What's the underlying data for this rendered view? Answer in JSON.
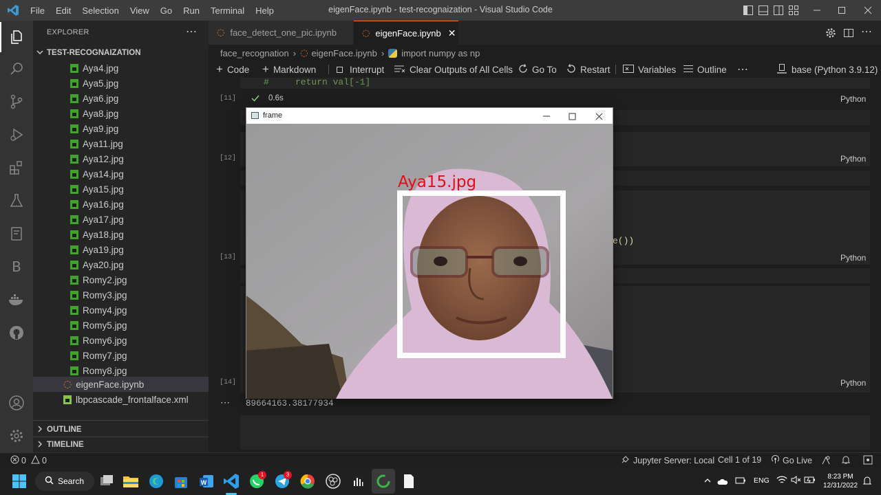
{
  "titlebar": {
    "menu": [
      "File",
      "Edit",
      "Selection",
      "View",
      "Go",
      "Run",
      "Terminal",
      "Help"
    ],
    "title": "eigenFace.ipynb - test-recognaization - Visual Studio Code"
  },
  "sidebar": {
    "header": "EXPLORER",
    "folder": "TEST-RECOGNAIZATION",
    "files": [
      "Aya4.jpg",
      "Aya5.jpg",
      "Aya6.jpg",
      "Aya8.jpg",
      "Aya9.jpg",
      "Aya11.jpg",
      "Aya12.jpg",
      "Aya14.jpg",
      "Aya15.jpg",
      "Aya16.jpg",
      "Aya17.jpg",
      "Aya18.jpg",
      "Aya19.jpg",
      "Aya20.jpg",
      "Romy2.jpg",
      "Romy3.jpg",
      "Romy4.jpg",
      "Romy5.jpg",
      "Romy6.jpg",
      "Romy7.jpg",
      "Romy8.jpg"
    ],
    "active_file": "eigenFace.ipynb",
    "xml_file": "lbpcascade_frontalface.xml",
    "outline": "OUTLINE",
    "timeline": "TIMELINE"
  },
  "tabs": [
    {
      "label": "face_detect_one_pic.ipynb"
    },
    {
      "label": "eigenFace.ipynb"
    }
  ],
  "breadcrumb": [
    "face_recognation",
    "eigenFace.ipynb",
    "import numpy as np"
  ],
  "toolbar": {
    "code": "Code",
    "markdown": "Markdown",
    "interrupt": "Interrupt",
    "clear": "Clear Outputs of All Cells",
    "goto": "Go To",
    "restart": "Restart",
    "variables": "Variables",
    "outline": "Outline",
    "kernel": "base (Python 3.9.12)"
  },
  "cells": {
    "code_line_hash": "#",
    "code_line_return": "return val[-1]",
    "exec_11": "[11]",
    "exec_12": "[12]",
    "exec_13": "[13]",
    "exec_14": "[14]",
    "time": "0.6s",
    "lang": "Python",
    "partial_code": "e())",
    "output": "89664163.38177934"
  },
  "frame_window": {
    "title": "frame",
    "label": "Aya15.jpg",
    "label_color": "#e0101a"
  },
  "statusbar": {
    "errors": "0",
    "warnings": "0",
    "jupyter": "Jupyter Server: Local",
    "cell": "Cell 1 of 19",
    "golive": "Go Live"
  },
  "taskbar": {
    "search": "Search",
    "lang": "ENG",
    "time": "8:23 PM",
    "date": "12/31/2022",
    "whatsapp_badge": "1",
    "telegram_badge": "3"
  },
  "colors": {
    "accent": "#007acc",
    "check": "#89d185",
    "number": "#569cd6"
  }
}
